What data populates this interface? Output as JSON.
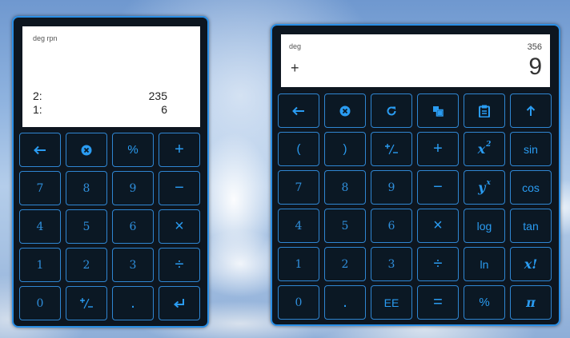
{
  "calc_rpn": {
    "mode": "deg rpn",
    "stack": [
      {
        "index": "2:",
        "value": "235"
      },
      {
        "index": "1:",
        "value": "6"
      }
    ],
    "keys": [
      {
        "name": "backspace-key",
        "icon": "arrow-left-icon",
        "label": "←"
      },
      {
        "name": "clear-key",
        "icon": "clear-x-icon",
        "label": ""
      },
      {
        "name": "percent-key",
        "label": "%"
      },
      {
        "name": "plus-key",
        "label": "+"
      },
      {
        "name": "digit-7-key",
        "label": "7",
        "kind": "num"
      },
      {
        "name": "digit-8-key",
        "label": "8",
        "kind": "num"
      },
      {
        "name": "digit-9-key",
        "label": "9",
        "kind": "num"
      },
      {
        "name": "minus-key",
        "label": "−"
      },
      {
        "name": "digit-4-key",
        "label": "4",
        "kind": "num"
      },
      {
        "name": "digit-5-key",
        "label": "5",
        "kind": "num"
      },
      {
        "name": "digit-6-key",
        "label": "6",
        "kind": "num"
      },
      {
        "name": "multiply-key",
        "label": "×"
      },
      {
        "name": "digit-1-key",
        "label": "1",
        "kind": "num"
      },
      {
        "name": "digit-2-key",
        "label": "2",
        "kind": "num"
      },
      {
        "name": "digit-3-key",
        "label": "3",
        "kind": "num"
      },
      {
        "name": "divide-key",
        "label": "÷"
      },
      {
        "name": "digit-0-key",
        "label": "0",
        "kind": "num"
      },
      {
        "name": "negate-key",
        "icon": "plus-minus-icon",
        "label": "⁺∕₋"
      },
      {
        "name": "decimal-key",
        "label": "."
      },
      {
        "name": "enter-key",
        "icon": "enter-icon",
        "label": "↵"
      }
    ]
  },
  "calc_sci": {
    "mode": "deg",
    "previous_value": "356",
    "operator": "+",
    "current_value": "9",
    "keys": [
      {
        "name": "backspace-key",
        "icon": "arrow-left-icon",
        "label": "←"
      },
      {
        "name": "clear-key",
        "icon": "clear-x-icon",
        "label": ""
      },
      {
        "name": "refresh-key",
        "icon": "refresh-icon",
        "label": ""
      },
      {
        "name": "copy-key",
        "icon": "copy-icon",
        "label": ""
      },
      {
        "name": "paste-key",
        "icon": "clipboard-icon",
        "label": ""
      },
      {
        "name": "shift-key",
        "icon": "arrow-up-icon",
        "label": "↑"
      },
      {
        "name": "open-paren-key",
        "label": "("
      },
      {
        "name": "close-paren-key",
        "label": ")"
      },
      {
        "name": "negate-key",
        "icon": "plus-minus-icon",
        "label": "⁺∕₋"
      },
      {
        "name": "plus-key",
        "label": "+"
      },
      {
        "name": "square-key",
        "label": "x",
        "sup": "2",
        "kind": "it"
      },
      {
        "name": "sin-key",
        "label": "sin",
        "kind": "fn"
      },
      {
        "name": "digit-7-key",
        "label": "7",
        "kind": "num"
      },
      {
        "name": "digit-8-key",
        "label": "8",
        "kind": "num"
      },
      {
        "name": "digit-9-key",
        "label": "9",
        "kind": "num"
      },
      {
        "name": "minus-key",
        "label": "−"
      },
      {
        "name": "power-key",
        "label": "y",
        "sup": "x",
        "kind": "it"
      },
      {
        "name": "cos-key",
        "label": "cos",
        "kind": "fn"
      },
      {
        "name": "digit-4-key",
        "label": "4",
        "kind": "num"
      },
      {
        "name": "digit-5-key",
        "label": "5",
        "kind": "num"
      },
      {
        "name": "digit-6-key",
        "label": "6",
        "kind": "num"
      },
      {
        "name": "multiply-key",
        "label": "×"
      },
      {
        "name": "log-key",
        "label": "log",
        "kind": "fn"
      },
      {
        "name": "tan-key",
        "label": "tan",
        "kind": "fn"
      },
      {
        "name": "digit-1-key",
        "label": "1",
        "kind": "num"
      },
      {
        "name": "digit-2-key",
        "label": "2",
        "kind": "num"
      },
      {
        "name": "digit-3-key",
        "label": "3",
        "kind": "num"
      },
      {
        "name": "divide-key",
        "label": "÷"
      },
      {
        "name": "ln-key",
        "label": "ln",
        "kind": "fn"
      },
      {
        "name": "factorial-key",
        "label": "x!",
        "kind": "it"
      },
      {
        "name": "digit-0-key",
        "label": "0",
        "kind": "num"
      },
      {
        "name": "decimal-key",
        "label": "."
      },
      {
        "name": "exponent-key",
        "label": "EE",
        "kind": "fn"
      },
      {
        "name": "equals-key",
        "label": "="
      },
      {
        "name": "percent-key",
        "label": "%"
      },
      {
        "name": "pi-key",
        "label": "π",
        "kind": "it"
      }
    ]
  }
}
